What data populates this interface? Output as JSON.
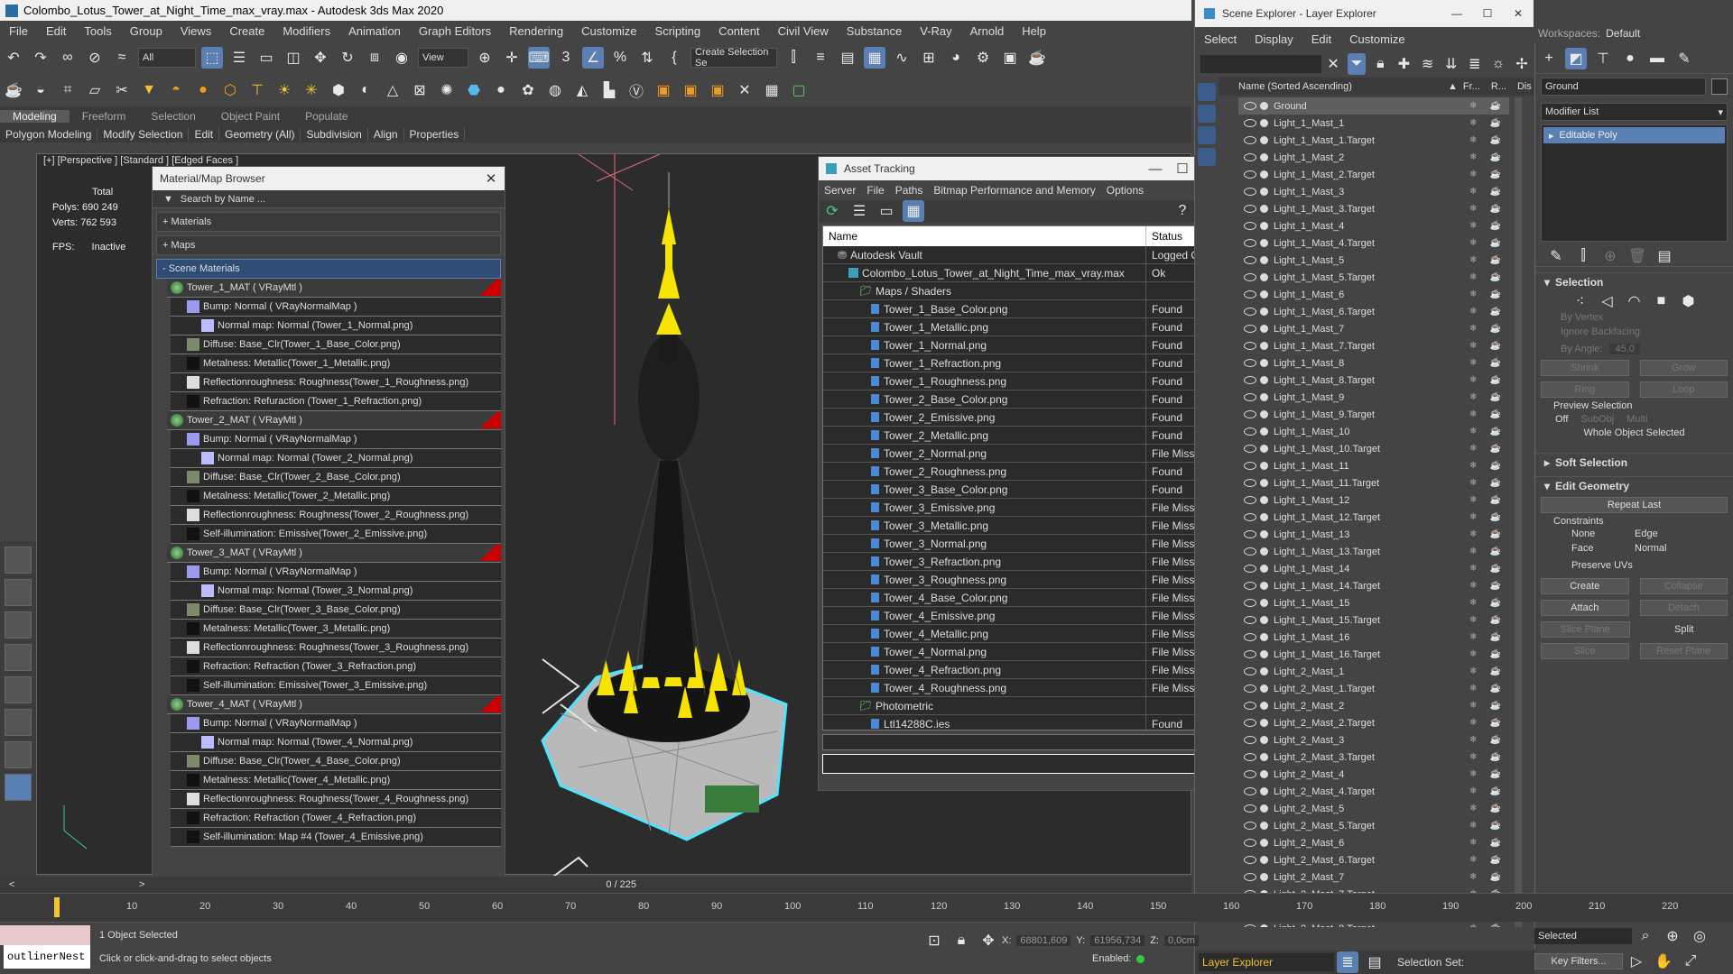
{
  "app": {
    "title": "Colombo_Lotus_Tower_at_Night_Time_max_vray.max - Autodesk 3ds Max 2020",
    "workspace_label": "Workspaces:",
    "workspace_value": "Default"
  },
  "menu": [
    "File",
    "Edit",
    "Tools",
    "Group",
    "Views",
    "Create",
    "Modifiers",
    "Animation",
    "Graph Editors",
    "Rendering",
    "Customize",
    "Scripting",
    "Content",
    "Civil View",
    "Substance",
    "V-Ray",
    "Arnold",
    "Help"
  ],
  "toolbar": {
    "filter_value": "All",
    "view_value": "View",
    "selection_set": "Create Selection Se"
  },
  "ribbon": {
    "tabs": [
      "Modeling",
      "Freeform",
      "Selection",
      "Object Paint",
      "Populate"
    ],
    "subtabs": [
      "Polygon Modeling",
      "Modify Selection",
      "Edit",
      "Geometry (All)",
      "Subdivision",
      "Align",
      "Properties"
    ]
  },
  "viewport": {
    "label": "[+] [Perspective ] [Standard ] [Edged Faces ]",
    "total_label": "Total",
    "polys_label": "Polys:",
    "polys_value": "690 249",
    "verts_label": "Verts:",
    "verts_value": "762 593",
    "fps_label": "FPS:",
    "fps_value": "Inactive"
  },
  "material_browser": {
    "title": "Material/Map Browser",
    "search_placeholder": "Search by Name ...",
    "groups": [
      "+ Materials",
      "+ Maps",
      "- Scene Materials"
    ],
    "materials": [
      {
        "name": "Tower_1_MAT  ( VRayMtl )",
        "rows": [
          {
            "t": "Bump: Normal  ( VRayNormalMap )",
            "lvl": 1
          },
          {
            "t": "Normal map: Normal (Tower_1_Normal.png)",
            "lvl": 2
          },
          {
            "t": "Diffuse: Base_Clr(Tower_1_Base_Color.png)",
            "lvl": 1
          },
          {
            "t": "Metalness: Metallic(Tower_1_Metallic.png)",
            "lvl": 1
          },
          {
            "t": "Reflectionroughness: Roughness(Tower_1_Roughness.png)",
            "lvl": 1
          },
          {
            "t": "Refraction: Refuraction (Tower_1_Refraction.png)",
            "lvl": 1
          }
        ]
      },
      {
        "name": "Tower_2_MAT  ( VRayMtl )",
        "rows": [
          {
            "t": "Bump: Normal  ( VRayNormalMap )",
            "lvl": 1
          },
          {
            "t": "Normal map: Normal (Tower_2_Normal.png)",
            "lvl": 2
          },
          {
            "t": "Diffuse: Base_Clr(Tower_2_Base_Color.png)",
            "lvl": 1
          },
          {
            "t": "Metalness: Metallic(Tower_2_Metallic.png)",
            "lvl": 1
          },
          {
            "t": "Reflectionroughness: Roughness(Tower_2_Roughness.png)",
            "lvl": 1
          },
          {
            "t": "Self-illumination: Emissive(Tower_2_Emissive.png)",
            "lvl": 1
          }
        ]
      },
      {
        "name": "Tower_3_MAT  ( VRayMtl )",
        "rows": [
          {
            "t": "Bump: Normal  ( VRayNormalMap )",
            "lvl": 1
          },
          {
            "t": "Normal map: Normal (Tower_3_Normal.png)",
            "lvl": 2
          },
          {
            "t": "Diffuse: Base_Clr(Tower_3_Base_Color.png)",
            "lvl": 1
          },
          {
            "t": "Metalness: Metallic(Tower_3_Metallic.png)",
            "lvl": 1
          },
          {
            "t": "Reflectionroughness: Roughness(Tower_3_Roughness.png)",
            "lvl": 1
          },
          {
            "t": "Refraction: Refraction (Tower_3_Refraction.png)",
            "lvl": 1
          },
          {
            "t": "Self-illumination: Emissive(Tower_3_Emissive.png)",
            "lvl": 1
          }
        ]
      },
      {
        "name": "Tower_4_MAT  ( VRayMtl )",
        "rows": [
          {
            "t": "Bump: Normal  ( VRayNormalMap )",
            "lvl": 1
          },
          {
            "t": "Normal map: Normal (Tower_4_Normal.png)",
            "lvl": 2
          },
          {
            "t": "Diffuse: Base_Clr(Tower_4_Base_Color.png)",
            "lvl": 1
          },
          {
            "t": "Metalness: Metallic(Tower_4_Metallic.png)",
            "lvl": 1
          },
          {
            "t": "Reflectionroughness: Roughness(Tower_4_Roughness.png)",
            "lvl": 1
          },
          {
            "t": "Refraction: Refraction (Tower_4_Refraction.png)",
            "lvl": 1
          },
          {
            "t": "Self-illumination: Map #4 (Tower_4_Emissive.png)",
            "lvl": 1
          }
        ]
      }
    ]
  },
  "asset_tracking": {
    "title": "Asset Tracking",
    "menu": [
      "Server",
      "File",
      "Paths",
      "Bitmap Performance and Memory",
      "Options"
    ],
    "col_name": "Name",
    "col_status": "Status",
    "rows": [
      {
        "n": "Autodesk Vault",
        "s": "Logged Out ...",
        "ind": 1,
        "kind": "vault"
      },
      {
        "n": "Colombo_Lotus_Tower_at_Night_Time_max_vray.max",
        "s": "Ok",
        "ind": 2,
        "kind": "max"
      },
      {
        "n": "Maps / Shaders",
        "s": "",
        "ind": 3,
        "kind": "folder"
      },
      {
        "n": "Tower_1_Base_Color.png",
        "s": "Found",
        "ind": 4,
        "kind": "file"
      },
      {
        "n": "Tower_1_Metallic.png",
        "s": "Found",
        "ind": 4,
        "kind": "file"
      },
      {
        "n": "Tower_1_Normal.png",
        "s": "Found",
        "ind": 4,
        "kind": "file"
      },
      {
        "n": "Tower_1_Refraction.png",
        "s": "Found",
        "ind": 4,
        "kind": "file"
      },
      {
        "n": "Tower_1_Roughness.png",
        "s": "Found",
        "ind": 4,
        "kind": "file"
      },
      {
        "n": "Tower_2_Base_Color.png",
        "s": "Found",
        "ind": 4,
        "kind": "file"
      },
      {
        "n": "Tower_2_Emissive.png",
        "s": "Found",
        "ind": 4,
        "kind": "file"
      },
      {
        "n": "Tower_2_Metallic.png",
        "s": "Found",
        "ind": 4,
        "kind": "file"
      },
      {
        "n": "Tower_2_Normal.png",
        "s": "File Missing",
        "ind": 4,
        "kind": "file"
      },
      {
        "n": "Tower_2_Roughness.png",
        "s": "Found",
        "ind": 4,
        "kind": "file"
      },
      {
        "n": "Tower_3_Base_Color.png",
        "s": "Found",
        "ind": 4,
        "kind": "file"
      },
      {
        "n": "Tower_3_Emissive.png",
        "s": "File Missing",
        "ind": 4,
        "kind": "file"
      },
      {
        "n": "Tower_3_Metallic.png",
        "s": "File Missing",
        "ind": 4,
        "kind": "file"
      },
      {
        "n": "Tower_3_Normal.png",
        "s": "File Missing",
        "ind": 4,
        "kind": "file"
      },
      {
        "n": "Tower_3_Refraction.png",
        "s": "File Missing",
        "ind": 4,
        "kind": "file"
      },
      {
        "n": "Tower_3_Roughness.png",
        "s": "File Missing",
        "ind": 4,
        "kind": "file"
      },
      {
        "n": "Tower_4_Base_Color.png",
        "s": "File Missing",
        "ind": 4,
        "kind": "file"
      },
      {
        "n": "Tower_4_Emissive.png",
        "s": "File Missing",
        "ind": 4,
        "kind": "file"
      },
      {
        "n": "Tower_4_Metallic.png",
        "s": "File Missing",
        "ind": 4,
        "kind": "file"
      },
      {
        "n": "Tower_4_Normal.png",
        "s": "File Missing",
        "ind": 4,
        "kind": "file"
      },
      {
        "n": "Tower_4_Refraction.png",
        "s": "File Missing",
        "ind": 4,
        "kind": "file"
      },
      {
        "n": "Tower_4_Roughness.png",
        "s": "File Missing",
        "ind": 4,
        "kind": "file"
      },
      {
        "n": "Photometric",
        "s": "",
        "ind": 3,
        "kind": "folder"
      },
      {
        "n": "Ltl14288C.ies",
        "s": "Found",
        "ind": 4,
        "kind": "file"
      }
    ]
  },
  "scene_explorer": {
    "title": "Scene Explorer - Layer Explorer",
    "menu": [
      "Select",
      "Display",
      "Edit",
      "Customize"
    ],
    "col_name": "Name (Sorted Ascending)",
    "col_fr": "Fr...",
    "col_r": "R...",
    "col_dis": "Dis",
    "items": [
      "Ground",
      "Light_1_Mast_1",
      "Light_1_Mast_1.Target",
      "Light_1_Mast_2",
      "Light_1_Mast_2.Target",
      "Light_1_Mast_3",
      "Light_1_Mast_3.Target",
      "Light_1_Mast_4",
      "Light_1_Mast_4.Target",
      "Light_1_Mast_5",
      "Light_1_Mast_5.Target",
      "Light_1_Mast_6",
      "Light_1_Mast_6.Target",
      "Light_1_Mast_7",
      "Light_1_Mast_7.Target",
      "Light_1_Mast_8",
      "Light_1_Mast_8.Target",
      "Light_1_Mast_9",
      "Light_1_Mast_9.Target",
      "Light_1_Mast_10",
      "Light_1_Mast_10.Target",
      "Light_1_Mast_11",
      "Light_1_Mast_11.Target",
      "Light_1_Mast_12",
      "Light_1_Mast_12.Target",
      "Light_1_Mast_13",
      "Light_1_Mast_13.Target",
      "Light_1_Mast_14",
      "Light_1_Mast_14.Target",
      "Light_1_Mast_15",
      "Light_1_Mast_15.Target",
      "Light_1_Mast_16",
      "Light_1_Mast_16.Target",
      "Light_2_Mast_1",
      "Light_2_Mast_1.Target",
      "Light_2_Mast_2",
      "Light_2_Mast_2.Target",
      "Light_2_Mast_3",
      "Light_2_Mast_3.Target",
      "Light_2_Mast_4",
      "Light_2_Mast_4.Target",
      "Light_2_Mast_5",
      "Light_2_Mast_5.Target",
      "Light_2_Mast_6",
      "Light_2_Mast_6.Target",
      "Light_2_Mast_7",
      "Light_2_Mast_7.Target",
      "Light_2_Mast_8",
      "Light_2_Mast_8.Target"
    ],
    "bottom_label": "Layer Explorer",
    "selection_set_label": "Selection Set:"
  },
  "command_panel": {
    "object_name": "Ground",
    "modifier_list": "Modifier List",
    "stack_item": "Editable Poly",
    "selection": "Selection",
    "by_vertex": "By Vertex",
    "ignore_backfacing": "Ignore Backfacing",
    "by_angle": "By Angle:",
    "by_angle_value": "45,0",
    "shrink": "Shrink",
    "grow": "Grow",
    "ring": "Ring",
    "loop": "Loop",
    "preview_selection": "Preview Selection",
    "off": "Off",
    "subobj": "SubObj",
    "multi": "Multi",
    "whole_object": "Whole Object Selected",
    "soft_selection": "Soft Selection",
    "edit_geometry": "Edit Geometry",
    "repeat_last": "Repeat Last",
    "constraints": "Constraints",
    "none": "None",
    "edge": "Edge",
    "face": "Face",
    "normal": "Normal",
    "preserve_uvs": "Preserve UVs",
    "create": "Create",
    "collapse": "Collapse",
    "attach": "Attach",
    "detach": "Detach",
    "slice_plane": "Slice Plane",
    "split": "Split",
    "slice": "Slice",
    "reset_plane": "Reset Plane"
  },
  "timeline": {
    "frame_counter": "0 / 225",
    "ticks": [
      "10",
      "20",
      "30",
      "40",
      "50",
      "60",
      "70",
      "80",
      "90",
      "100",
      "110",
      "120",
      "130",
      "140",
      "150",
      "160",
      "170",
      "180",
      "190",
      "200",
      "210",
      "220"
    ]
  },
  "status": {
    "objects_selected": "1 Object Selected",
    "hint": "Click or click-and-drag to select objects",
    "x_label": "X:",
    "x_value": "68801,609",
    "y_label": "Y:",
    "y_value": "61956,734",
    "z_label": "Z:",
    "z_value": "0,0cm",
    "enabled": "Enabled:",
    "maxscript": "outlinerNest",
    "selected": "Selected",
    "key_filters": "Key Filters..."
  }
}
